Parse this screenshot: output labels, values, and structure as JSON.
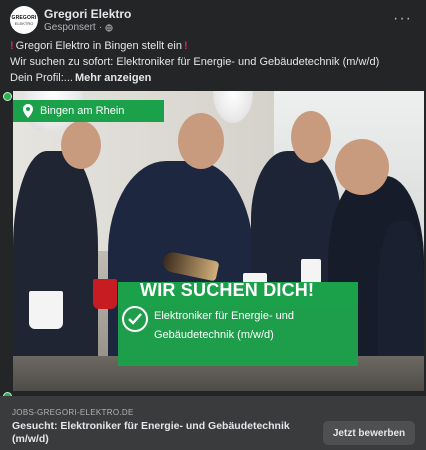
{
  "post": {
    "page_name": "Gregori Elektro",
    "sponsored": "Gesponsert",
    "more_glyph": "···",
    "avatar": {
      "line1": "GREGORI",
      "line2": "ELEKTRO"
    }
  },
  "text": {
    "excl": "!",
    "line1": "Gregori Elektro in Bingen stellt ein",
    "line2": "Wir suchen zu sofort: Elektroniker für Energie- und Gebäudetechnik (m/w/d)",
    "line3_prefix": "Dein Profil:...",
    "more_link": "Mehr anzeigen"
  },
  "image": {
    "location_label": "Bingen am Rhein",
    "headline": "WIR SUCHEN DICH!",
    "line2": "Elektroniker für Energie- und",
    "line3": "Gebäudetechnik (m/w/d)"
  },
  "footer": {
    "domain": "JOBS-GREGORI-ELEKTRO.DE",
    "headline": "Gesucht: Elektroniker für Energie- und Gebäudetechnik (m/w/d)",
    "cta": "Jetzt bewerben"
  },
  "colors": {
    "brand_green": "#1aa14a",
    "card_bg": "#242526",
    "footer_bg": "#3a3b3c"
  },
  "icons": [
    "globe-icon",
    "more-options-icon",
    "location-pin-icon",
    "checkmark-circle-icon",
    "verified-dot-icon"
  ]
}
